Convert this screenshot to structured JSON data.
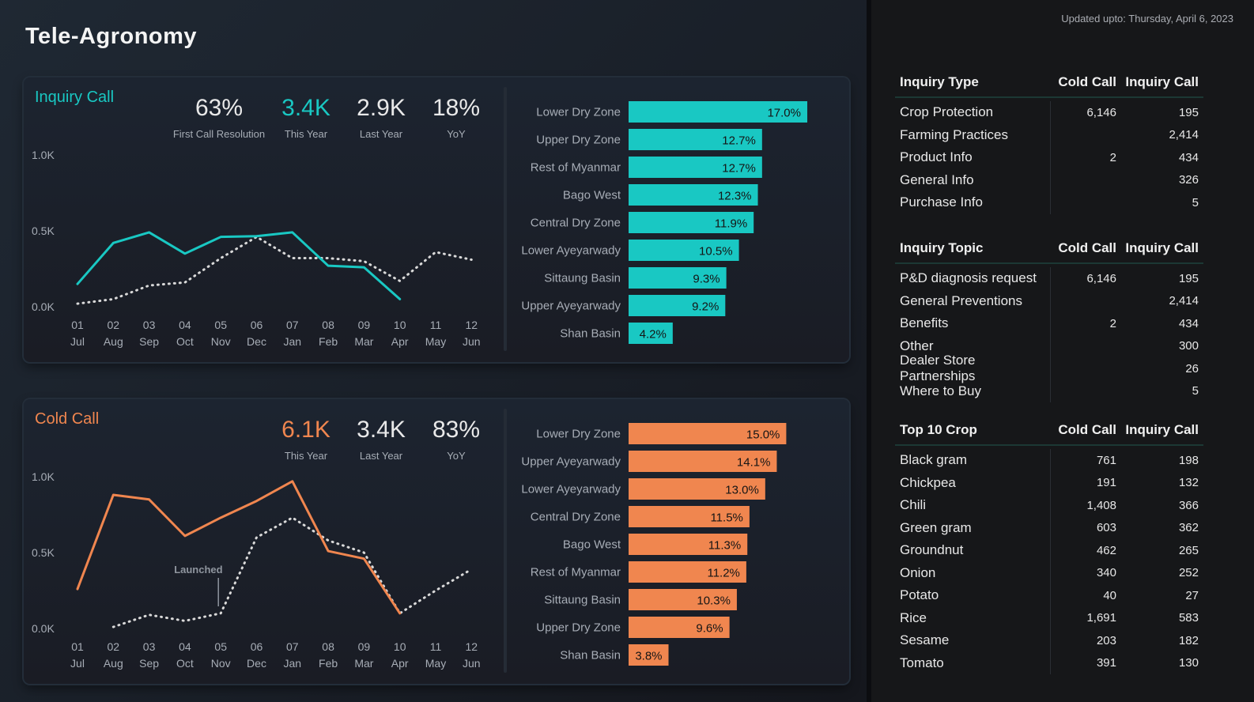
{
  "app_title": "Tele-Agronomy",
  "updated_label": "Updated upto: Thursday, April 6, 2023",
  "colors": {
    "teal": "#19c8c3",
    "orange": "#f0864f",
    "dotted": "#d9d9d9"
  },
  "inquiry": {
    "title": "Inquiry Call",
    "kpis": [
      {
        "value": "63%",
        "label": "First Call Resolution"
      },
      {
        "value": "3.4K",
        "label": "This Year"
      },
      {
        "value": "2.9K",
        "label": "Last Year"
      },
      {
        "value": "18%",
        "label": "YoY"
      }
    ]
  },
  "cold": {
    "title": "Cold Call",
    "kpis": [
      {
        "value": "6.1K",
        "label": "This Year"
      },
      {
        "value": "3.4K",
        "label": "Last Year"
      },
      {
        "value": "83%",
        "label": "YoY"
      }
    ],
    "annotation": "Launched"
  },
  "chart_data": [
    {
      "type": "line",
      "id": "inquiry-line",
      "x_top": [
        "01",
        "02",
        "03",
        "04",
        "05",
        "06",
        "07",
        "08",
        "09",
        "10",
        "11",
        "12"
      ],
      "x_bottom": [
        "Jul",
        "Aug",
        "Sep",
        "Oct",
        "Nov",
        "Dec",
        "Jan",
        "Feb",
        "Mar",
        "Apr",
        "May",
        "Jun"
      ],
      "y_ticks": [
        "0.0K",
        "0.5K",
        "1.0K"
      ],
      "ylim": [
        0,
        1000
      ],
      "series": [
        {
          "style": "solid",
          "values": [
            150,
            420,
            490,
            350,
            460,
            465,
            490,
            270,
            260,
            50,
            null,
            null
          ]
        },
        {
          "style": "dotted",
          "values": [
            20,
            50,
            140,
            160,
            320,
            460,
            320,
            320,
            300,
            170,
            360,
            310
          ]
        }
      ]
    },
    {
      "type": "bar",
      "id": "inquiry-bar",
      "categories": [
        "Lower Dry Zone",
        "Upper Dry Zone",
        "Rest of Myanmar",
        "Bago West",
        "Central Dry Zone",
        "Lower Ayeyarwady",
        "Sittaung Basin",
        "Upper Ayeyarwady",
        "Shan Basin"
      ],
      "values": [
        17.0,
        12.7,
        12.7,
        12.3,
        11.9,
        10.5,
        9.3,
        9.2,
        4.2
      ],
      "labels": [
        "17.0%",
        "12.7%",
        "12.7%",
        "12.3%",
        "11.9%",
        "10.5%",
        "9.3%",
        "9.2%",
        "4.2%"
      ],
      "xlim": [
        0,
        17.0
      ]
    },
    {
      "type": "line",
      "id": "cold-line",
      "x_top": [
        "01",
        "02",
        "03",
        "04",
        "05",
        "06",
        "07",
        "08",
        "09",
        "10",
        "11",
        "12"
      ],
      "x_bottom": [
        "Jul",
        "Aug",
        "Sep",
        "Oct",
        "Nov",
        "Dec",
        "Jan",
        "Feb",
        "Mar",
        "Apr",
        "May",
        "Jun"
      ],
      "y_ticks": [
        "0.0K",
        "0.5K",
        "1.0K"
      ],
      "ylim": [
        0,
        1000
      ],
      "series": [
        {
          "style": "solid",
          "values": [
            260,
            880,
            850,
            610,
            730,
            840,
            970,
            510,
            460,
            100,
            null,
            null
          ]
        },
        {
          "style": "dotted",
          "values": [
            null,
            10,
            90,
            50,
            100,
            600,
            730,
            580,
            500,
            100,
            250,
            390
          ]
        }
      ],
      "annotation_x_index": 4
    },
    {
      "type": "bar",
      "id": "cold-bar",
      "categories": [
        "Lower Dry Zone",
        "Upper Ayeyarwady",
        "Lower Ayeyarwady",
        "Central Dry Zone",
        "Bago West",
        "Rest of Myanmar",
        "Sittaung Basin",
        "Upper Dry Zone",
        "Shan Basin"
      ],
      "values": [
        15.0,
        14.1,
        13.0,
        11.5,
        11.3,
        11.2,
        10.3,
        9.6,
        3.8
      ],
      "labels": [
        "15.0%",
        "14.1%",
        "13.0%",
        "11.5%",
        "11.3%",
        "11.2%",
        "10.3%",
        "9.6%",
        "3.8%"
      ],
      "xlim": [
        0,
        17.0
      ]
    }
  ],
  "tables": [
    {
      "header": [
        "Inquiry Type",
        "Cold Call",
        "Inquiry Call"
      ],
      "rows": [
        [
          "Crop Protection",
          "6,146",
          "195"
        ],
        [
          "Farming Practices",
          "",
          "2,414"
        ],
        [
          "Product Info",
          "2",
          "434"
        ],
        [
          "General Info",
          "",
          "326"
        ],
        [
          "Purchase Info",
          "",
          "5"
        ]
      ]
    },
    {
      "header": [
        "Inquiry Topic",
        "Cold Call",
        "Inquiry Call"
      ],
      "rows": [
        [
          "P&D diagnosis request",
          "6,146",
          "195"
        ],
        [
          "General Preventions",
          "",
          "2,414"
        ],
        [
          "Benefits",
          "2",
          "434"
        ],
        [
          "Other",
          "",
          "300"
        ],
        [
          "Dealer Store Partnerships",
          "",
          "26"
        ],
        [
          "Where to Buy",
          "",
          "5"
        ]
      ]
    },
    {
      "header": [
        "Top 10 Crop",
        "Cold Call",
        "Inquiry Call"
      ],
      "rows": [
        [
          "Black gram",
          "761",
          "198"
        ],
        [
          "Chickpea",
          "191",
          "132"
        ],
        [
          "Chili",
          "1,408",
          "366"
        ],
        [
          "Green gram",
          "603",
          "362"
        ],
        [
          "Groundnut",
          "462",
          "265"
        ],
        [
          "Onion",
          "340",
          "252"
        ],
        [
          "Potato",
          "40",
          "27"
        ],
        [
          "Rice",
          "1,691",
          "583"
        ],
        [
          "Sesame",
          "203",
          "182"
        ],
        [
          "Tomato",
          "391",
          "130"
        ]
      ]
    }
  ]
}
